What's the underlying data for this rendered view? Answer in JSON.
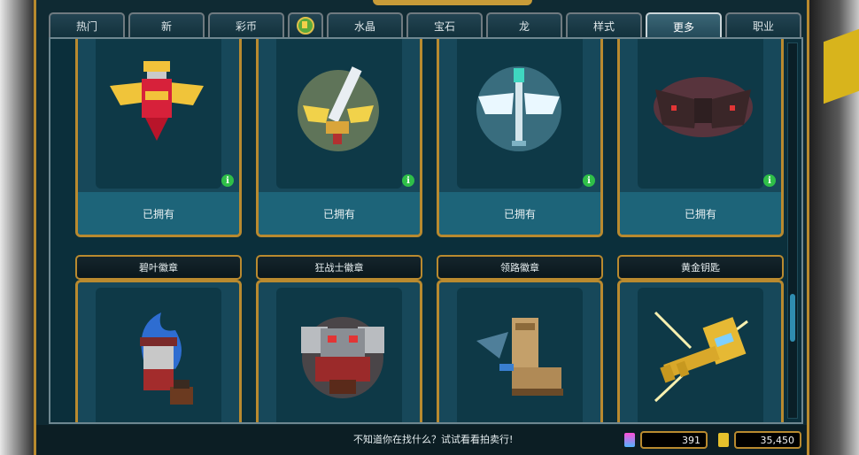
{
  "tabs": [
    {
      "label": "热门"
    },
    {
      "label": "新"
    },
    {
      "label": "彩币"
    },
    {
      "label": "",
      "icon": "coin-badge-icon"
    },
    {
      "label": "水晶"
    },
    {
      "label": "宝石"
    },
    {
      "label": "龙"
    },
    {
      "label": "样式"
    },
    {
      "label": "更多",
      "active": true
    },
    {
      "label": "职业"
    }
  ],
  "row1": [
    {
      "status": "已拥有",
      "icon": "winged-red-badge-icon"
    },
    {
      "status": "已拥有",
      "icon": "golden-winged-sword-icon"
    },
    {
      "status": "已拥有",
      "icon": "ice-winged-staff-icon"
    },
    {
      "status": "已拥有",
      "icon": "dark-red-bat-wings-icon"
    }
  ],
  "row2": [
    {
      "title": "碧叶徽章",
      "icon": "blue-flame-character-icon"
    },
    {
      "title": "狂战士徽章",
      "icon": "berserker-helmet-icon"
    },
    {
      "title": "领路徽章",
      "icon": "pathfinder-boot-icon"
    },
    {
      "title": "黄金钥匙",
      "icon": "golden-key-icon"
    }
  ],
  "footer": {
    "hint": "不知道你在找什么？试试看看拍卖行!",
    "currency1": "391",
    "currency2": "35,450"
  },
  "colors": {
    "gold": "#b98a2f",
    "panel": "#0b2f3b",
    "accent": "#1d6479"
  }
}
